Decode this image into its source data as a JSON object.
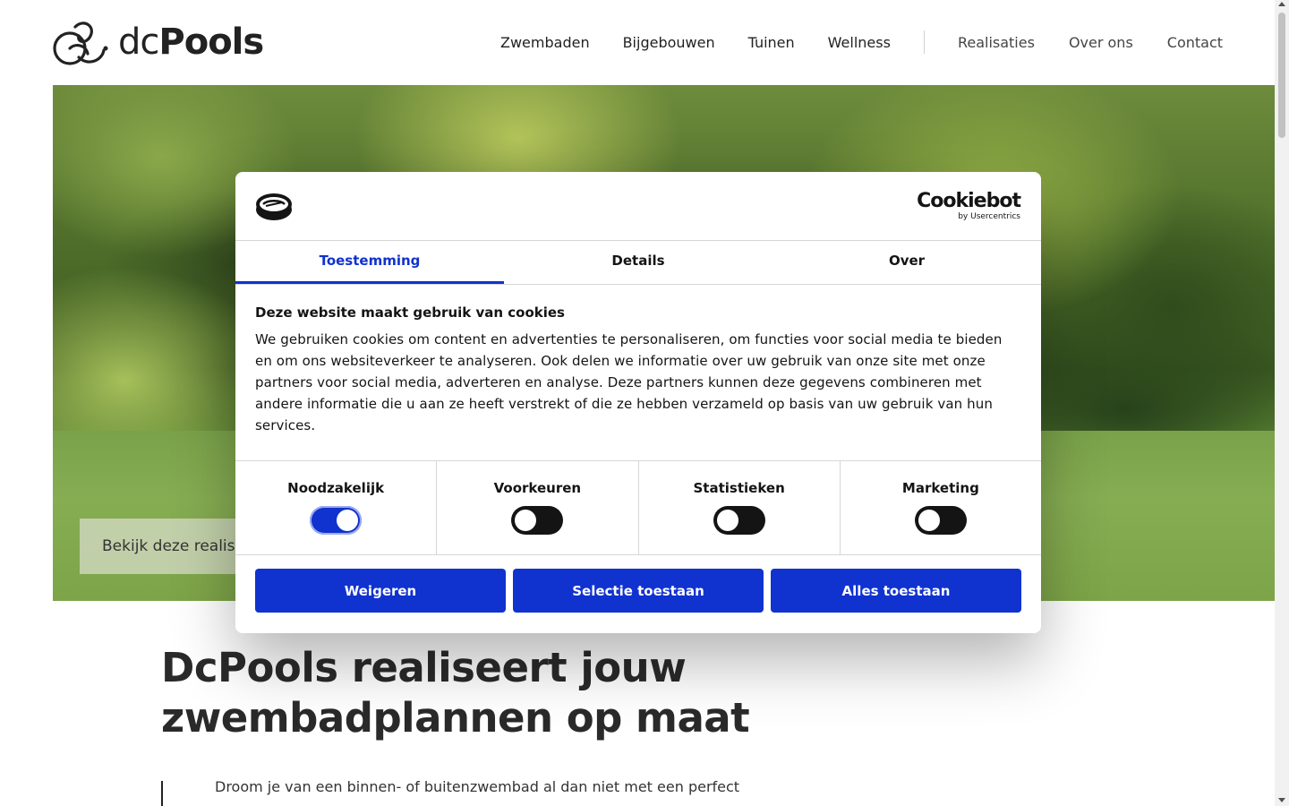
{
  "brand": {
    "logo_prefix": "dc",
    "logo_name": "Pools"
  },
  "nav": {
    "primary": [
      "Zwembaden",
      "Bijgebouwen",
      "Tuinen",
      "Wellness"
    ],
    "secondary": [
      "Realisaties",
      "Over ons",
      "Contact"
    ]
  },
  "hero": {
    "cta_label": "Bekijk deze realisatie"
  },
  "main": {
    "headline_line1": "DcPools realiseert jouw",
    "headline_line2": "zwembadplannen op maat",
    "intro": "Droom je van een binnen- of buitenzwembad al dan niet met een perfect"
  },
  "cookie": {
    "brand_name": "Cookiebot",
    "brand_sub": "by Usercentrics",
    "tabs": [
      "Toestemming",
      "Details",
      "Over"
    ],
    "active_tab": "Toestemming",
    "title": "Deze website maakt gebruik van cookies",
    "body": "We gebruiken cookies om content en advertenties te personaliseren, om functies voor social media te bieden en om ons websiteverkeer te analyseren. Ook delen we informatie over uw gebruik van onze site met onze partners voor social media, adverteren en analyse. Deze partners kunnen deze gegevens combineren met andere informatie die u aan ze heeft verstrekt of die ze hebben verzameld op basis van uw gebruik van hun services.",
    "toggles": [
      {
        "label": "Noodzakelijk",
        "on": true
      },
      {
        "label": "Voorkeuren",
        "on": false
      },
      {
        "label": "Statistieken",
        "on": false
      },
      {
        "label": "Marketing",
        "on": false
      }
    ],
    "buttons": [
      "Weigeren",
      "Selectie toestaan",
      "Alles toestaan"
    ]
  },
  "colors": {
    "accent": "#1032cf",
    "text": "#141414"
  }
}
